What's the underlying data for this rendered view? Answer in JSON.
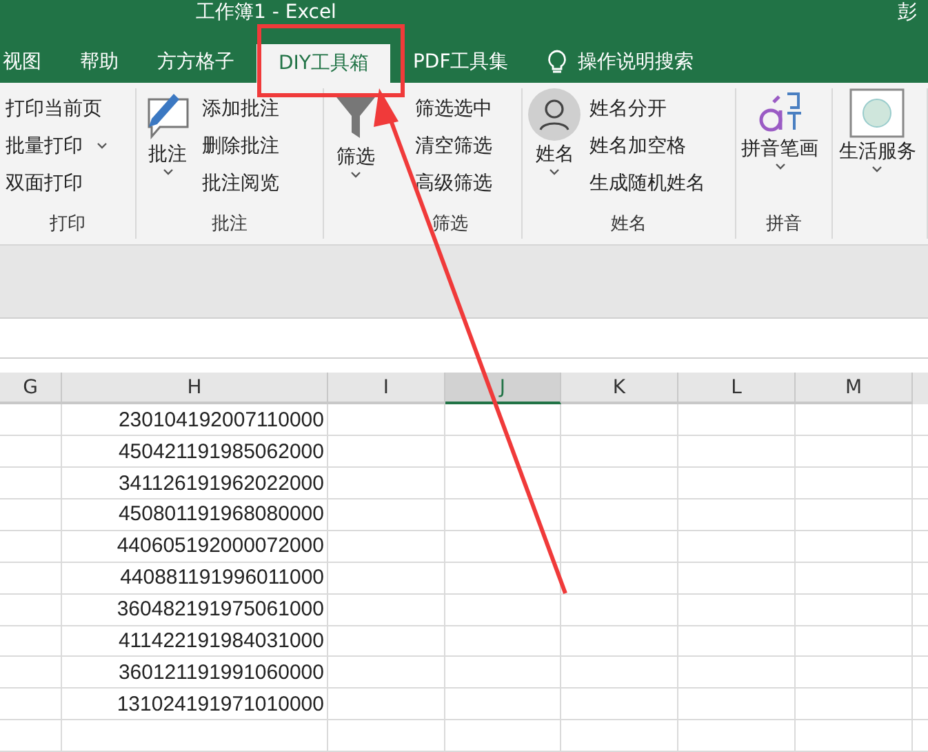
{
  "window": {
    "title": "工作簿1  -  Excel",
    "user": "彭"
  },
  "tabs": [
    {
      "label": "视图",
      "selected": false,
      "kind": "tab"
    },
    {
      "label": "帮助",
      "selected": false,
      "kind": "tab"
    },
    {
      "label": "方方格子",
      "selected": false,
      "kind": "tab"
    },
    {
      "label": "DIY工具箱",
      "selected": true,
      "kind": "tab"
    },
    {
      "label": "PDF工具集",
      "selected": false,
      "kind": "tab"
    },
    {
      "label": "操作说明搜索",
      "selected": false,
      "kind": "search"
    }
  ],
  "ribbon": {
    "groups": [
      {
        "label": "打印",
        "items": [
          {
            "label": "打印当前页",
            "dropdown": false
          },
          {
            "label": "批量打印",
            "dropdown": true
          },
          {
            "label": "双面打印",
            "dropdown": false
          }
        ]
      },
      {
        "label": "批注",
        "large": {
          "label": "批注",
          "kind": "comment",
          "dropdown": true
        },
        "items": [
          {
            "label": "添加批注",
            "dropdown": false
          },
          {
            "label": "删除批注",
            "dropdown": false
          },
          {
            "label": "批注阅览",
            "dropdown": false
          }
        ]
      },
      {
        "label": "筛选",
        "large": {
          "label": "筛选",
          "kind": "filter",
          "dropdown": true
        },
        "items": [
          {
            "label": "筛选选中",
            "dropdown": false
          },
          {
            "label": "清空筛选",
            "dropdown": false
          },
          {
            "label": "高级筛选",
            "dropdown": false
          }
        ]
      },
      {
        "label": "姓名",
        "large": {
          "label": "姓名",
          "kind": "person",
          "dropdown": true
        },
        "items": [
          {
            "label": "姓名分开",
            "dropdown": false
          },
          {
            "label": "姓名加空格",
            "dropdown": false
          },
          {
            "label": "生成随机姓名",
            "dropdown": false
          }
        ]
      },
      {
        "label": "拼音",
        "large": {
          "label": "拼音笔画",
          "kind": "pinyin",
          "dropdown": true
        }
      },
      {
        "large": {
          "label": "生活服务",
          "kind": "service",
          "dropdown": true
        }
      }
    ]
  },
  "sheet": {
    "columns": [
      {
        "label": "G",
        "selected": false
      },
      {
        "label": "H",
        "selected": false
      },
      {
        "label": "I",
        "selected": false
      },
      {
        "label": "J",
        "selected": true
      },
      {
        "label": "K",
        "selected": false
      },
      {
        "label": "L",
        "selected": false
      },
      {
        "label": "M",
        "selected": false
      }
    ],
    "rows": [
      "230104192007110000",
      "450421191985062000",
      "341126191962022000",
      "450801191968080000",
      "440605192000072000",
      "440881191996011000",
      "360482191975061000",
      "411422191984031000",
      "360121191991060000",
      "131024191971010000"
    ]
  }
}
